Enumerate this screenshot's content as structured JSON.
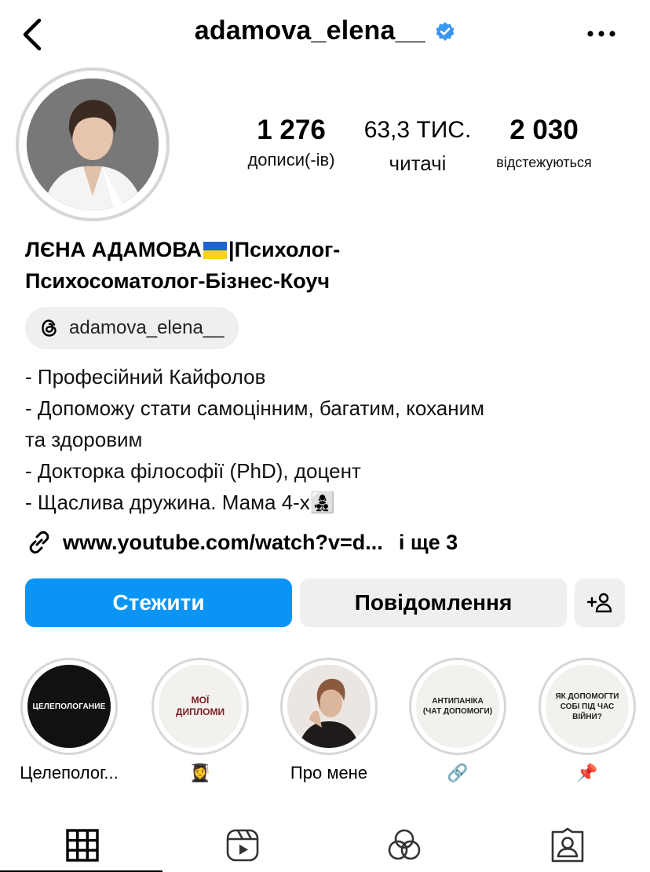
{
  "header": {
    "username": "adamova_elena__"
  },
  "stats": [
    {
      "value": "1 276",
      "label": "дописи(-ів)"
    },
    {
      "value": "63,3 ТИС.",
      "label": "читачі"
    },
    {
      "value": "2 030",
      "label": "відстежуються"
    }
  ],
  "profile": {
    "name_part1": "ЛЄНА АДАМОВА",
    "name_part2": "|Психолог-",
    "name_line2": "Психосоматолог-Бізнес-Коуч",
    "threads_handle": "adamova_elena__",
    "bio_lines": [
      "- Професійний Кайфолов",
      "- Допоможу стати самоцінним, багатим, коханим",
      "та здоровим",
      "- Докторка філософії (PhD), доцент",
      "- Щаслива дружина. Мама 4-х👩‍👧‍👦"
    ],
    "link_url": "www.youtube.com/watch?v=d...",
    "link_more": "і ще 3"
  },
  "actions": {
    "follow": "Стежити",
    "message": "Повідомлення"
  },
  "highlights": [
    {
      "cover_text": "ЦЕЛЕПОЛОГАНИЕ",
      "label": "Целеполог..."
    },
    {
      "cover_text_1": "МОЇ",
      "cover_text_2": "ДИПЛОМИ",
      "label": "👩‍🎓"
    },
    {
      "label": "Про мене"
    },
    {
      "cover_text_1": "АНТИПАНІКА",
      "cover_text_2": "(ЧАТ ДОПОМОГИ)",
      "label": "🔗"
    },
    {
      "cover_text_1": "ЯК ДОПОМОГТИ",
      "cover_text_2": "СОБІ ПІД ЧАС",
      "cover_text_3": "ВІЙНИ?",
      "label": "📌"
    }
  ],
  "colors": {
    "follow_button": "#0a95f6",
    "verified_badge": "#3897f0",
    "secondary_button": "#efefef"
  },
  "icons": {
    "back": "chevron-left-icon",
    "more": "more-horizontal-icon",
    "threads": "threads-icon",
    "link": "link-icon",
    "add_person": "add-person-icon",
    "tabs": [
      "grid-icon",
      "reels-icon",
      "collab-icon",
      "tagged-icon"
    ]
  }
}
